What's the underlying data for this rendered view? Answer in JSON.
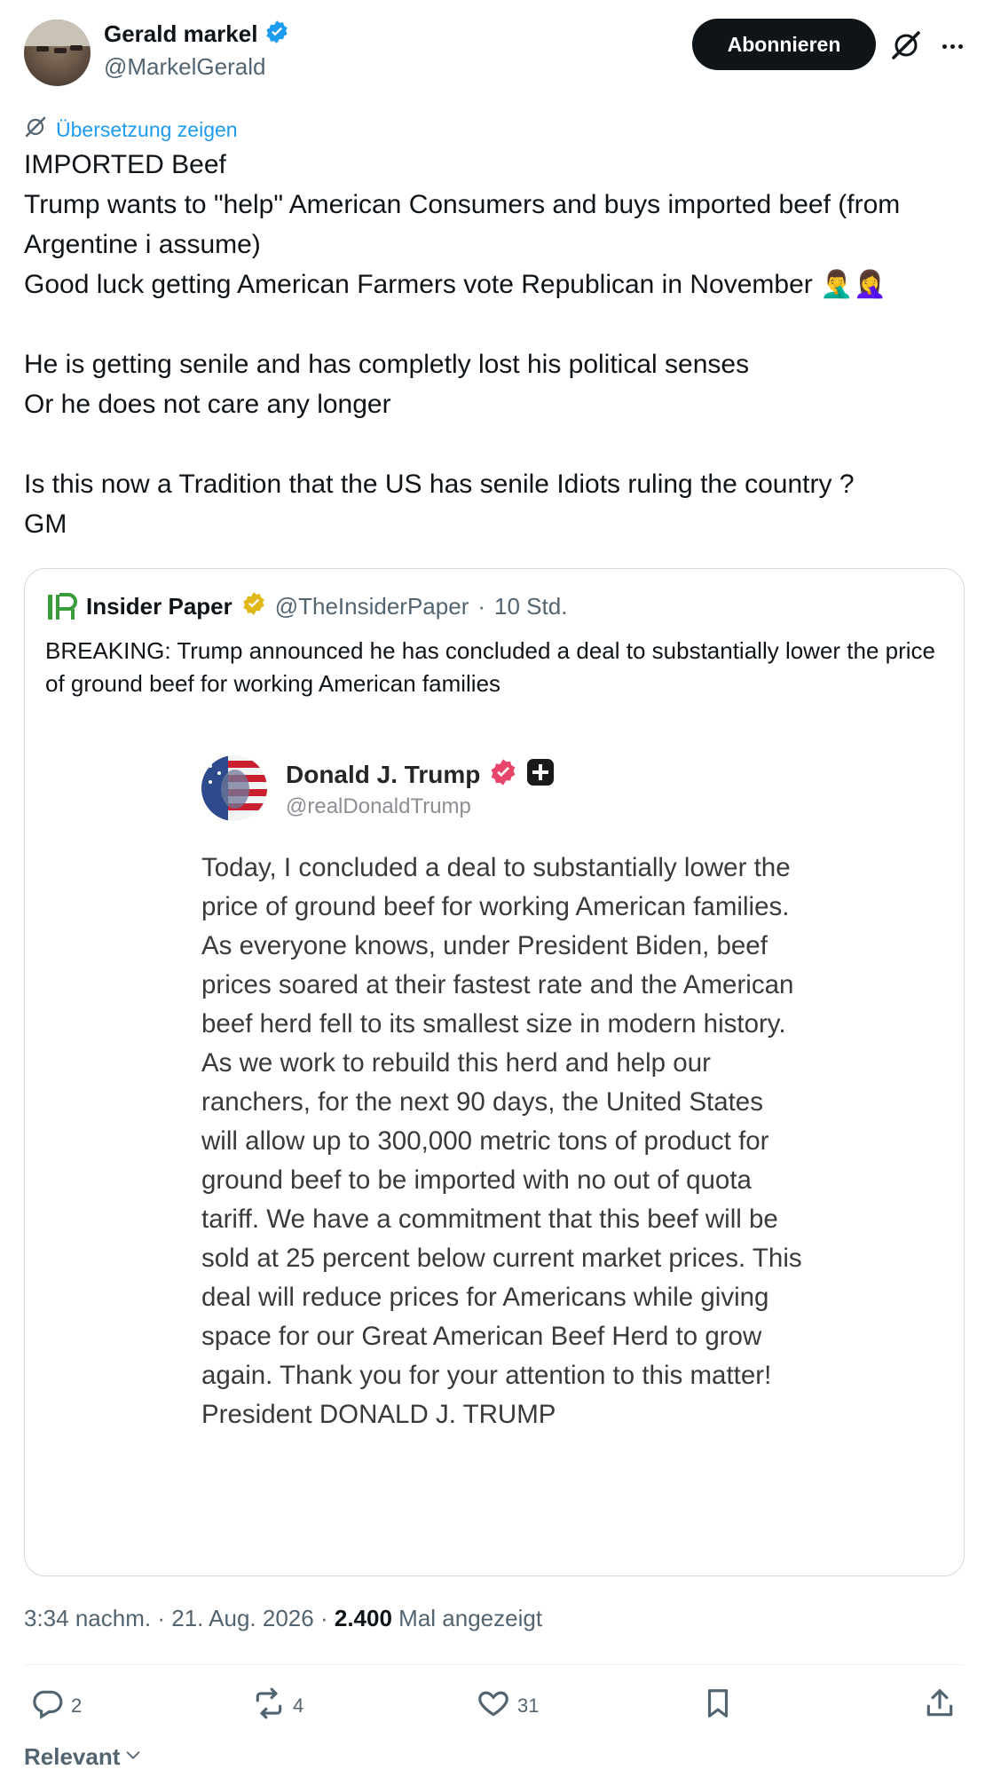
{
  "author": {
    "display_name": "Gerald markel",
    "handle": "@MarkelGerald"
  },
  "header": {
    "follow_label": "Abonnieren"
  },
  "translate_label": "Übersetzung zeigen",
  "tweet_text": "IMPORTED Beef\nTrump wants to \"help\" American Consumers and buys imported beef (from Argentine i assume)\nGood luck getting American Farmers vote Republican in November 🤦‍♂️🤦‍♀️\n\nHe is getting senile and has completly lost his political senses\nOr he does not care any longer\n\nIs this now a Tradition that the US has senile Idiots ruling the country ?\nGM",
  "quote": {
    "logo_text": "IP",
    "name": "Insider Paper",
    "handle": "@TheInsiderPaper",
    "separator": "·",
    "time": "10 Std.",
    "text": "BREAKING: Trump announced he has concluded a deal to substantially lower the price of ground beef for working American families",
    "embedded": {
      "name": "Donald J. Trump",
      "handle": "@realDonaldTrump",
      "text": "Today, I concluded a deal to substantially lower the price of ground beef for working American families. As everyone knows, under President Biden, beef prices soared at their fastest rate and the American beef herd fell to its smallest size in modern history. As we work to rebuild this herd and help our ranchers, for the next 90 days, the United States will allow up to 300,000 metric tons of product for ground beef to be imported with no out of quota tariff. We have a commitment that this beef will be sold at 25 percent below current market prices. This deal will reduce prices for Americans while giving space for our Great American Beef Herd to grow again. Thank you for your attention to this matter! President DONALD J. TRUMP"
    }
  },
  "meta": {
    "time": "3:34 nachm.",
    "date": "21. Aug. 2026",
    "views": "2.400",
    "views_label": "Mal angezeigt",
    "separator": "·"
  },
  "actions": {
    "replies": "2",
    "reposts": "4",
    "likes": "31"
  },
  "sort_label": "Relevant",
  "colors": {
    "accent": "#1d9bf0",
    "verified_blue": "#1d9bf0",
    "verified_gold": "#e2b719",
    "truth_pink": "#e8456b",
    "text_secondary": "#536471"
  }
}
